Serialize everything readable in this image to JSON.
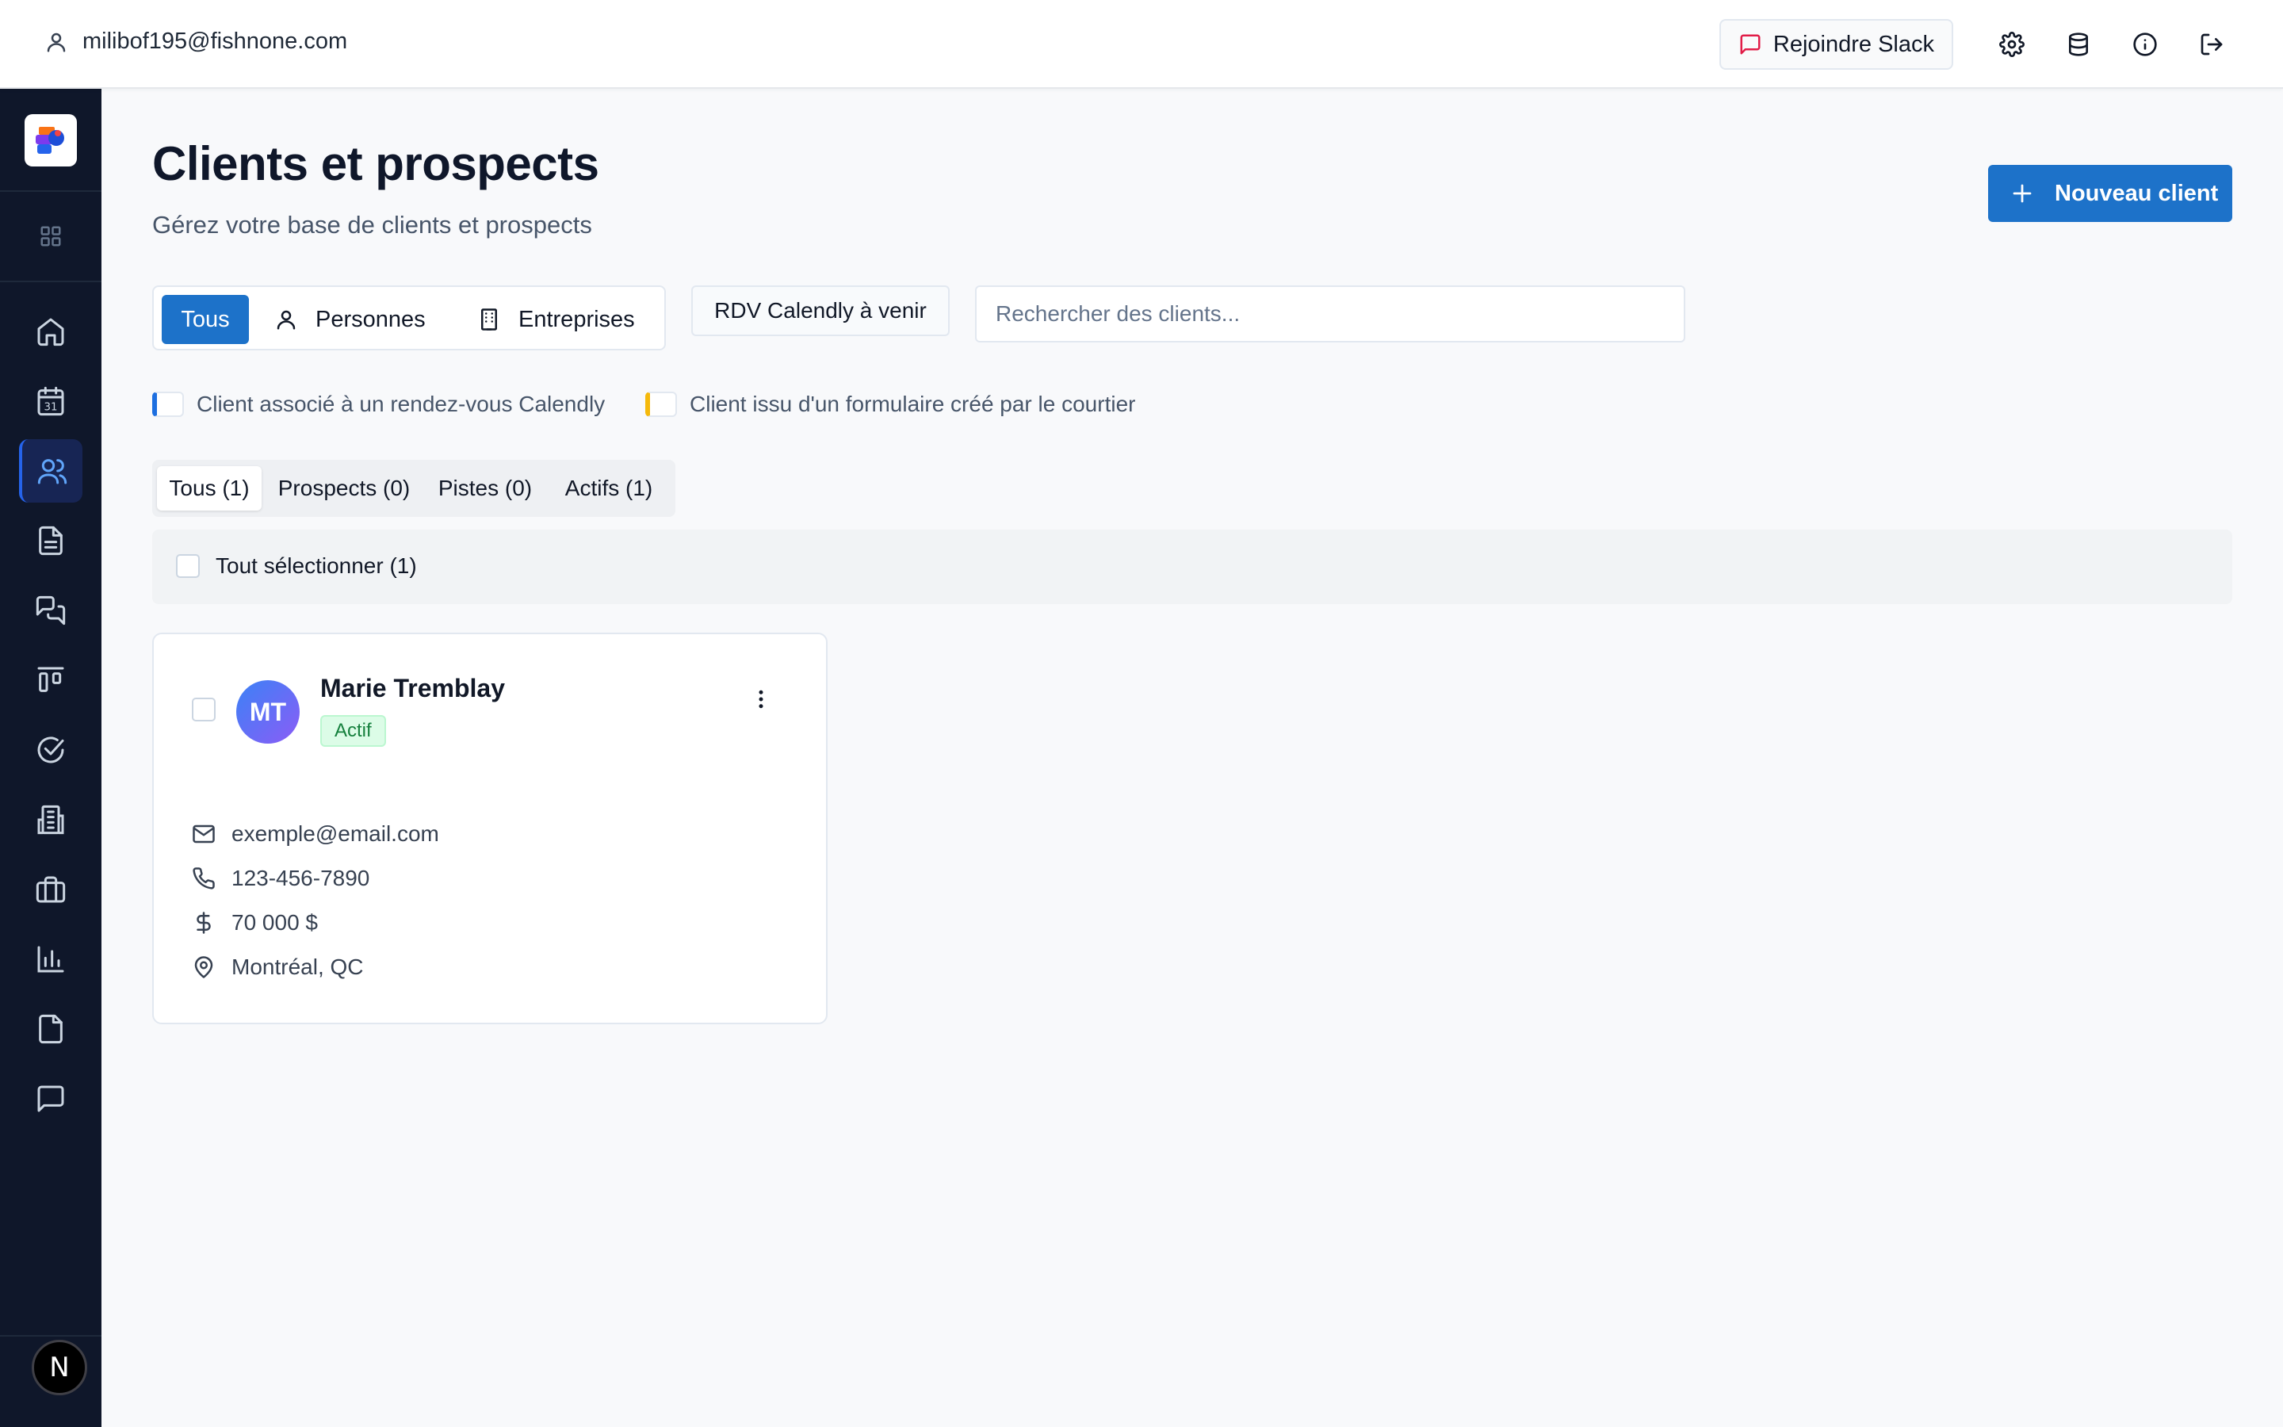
{
  "topbar": {
    "user_email": "milibof195@fishnone.com",
    "slack_label": "Rejoindre Slack",
    "icons": [
      "user-icon",
      "message-icon",
      "gear-icon",
      "database-icon",
      "info-icon",
      "logout-icon"
    ]
  },
  "sidebar": {
    "items": [
      {
        "name": "home-icon"
      },
      {
        "name": "calendar-icon",
        "text": "31"
      },
      {
        "name": "users-icon",
        "active": true
      },
      {
        "name": "document-icon"
      },
      {
        "name": "chat-icon"
      },
      {
        "name": "kanban-icon"
      },
      {
        "name": "check-circle-icon"
      },
      {
        "name": "building-icon"
      },
      {
        "name": "briefcase-icon"
      },
      {
        "name": "bar-chart-icon"
      },
      {
        "name": "file-icon"
      },
      {
        "name": "message-square-icon"
      }
    ],
    "footer_avatar": "N"
  },
  "page": {
    "title": "Clients et prospects",
    "subtitle": "Gérez votre base de clients et prospects",
    "new_client_label": "Nouveau client"
  },
  "filters": {
    "type_segments": [
      "Tous",
      "Personnes",
      "Entreprises"
    ],
    "active_segment": "Tous",
    "rdv_label": "RDV Calendly à venir",
    "search_placeholder": "Rechercher des clients..."
  },
  "legend": {
    "calendly": {
      "label": "Client associé à un rendez-vous Calendly",
      "color": "#1d6fe0"
    },
    "form": {
      "label": "Client issu d'un formulaire créé par le courtier",
      "color": "#f5b90b"
    }
  },
  "status_tabs": [
    {
      "label": "Tous (1)",
      "active": true
    },
    {
      "label": "Prospects (0)"
    },
    {
      "label": "Pistes (0)"
    },
    {
      "label": "Actifs (1)"
    }
  ],
  "select_all_label": "Tout sélectionner (1)",
  "clients": [
    {
      "initials": "MT",
      "name": "Marie Tremblay",
      "status": "Actif",
      "email": "exemple@email.com",
      "phone": "123-456-7890",
      "amount": "70 000 $",
      "location": "Montréal, QC"
    }
  ],
  "colors": {
    "primary": "#1d72c9",
    "sidebar_bg": "#0f172a",
    "active_badge_bg": "#dcfce7",
    "active_badge_text": "#15803d"
  }
}
